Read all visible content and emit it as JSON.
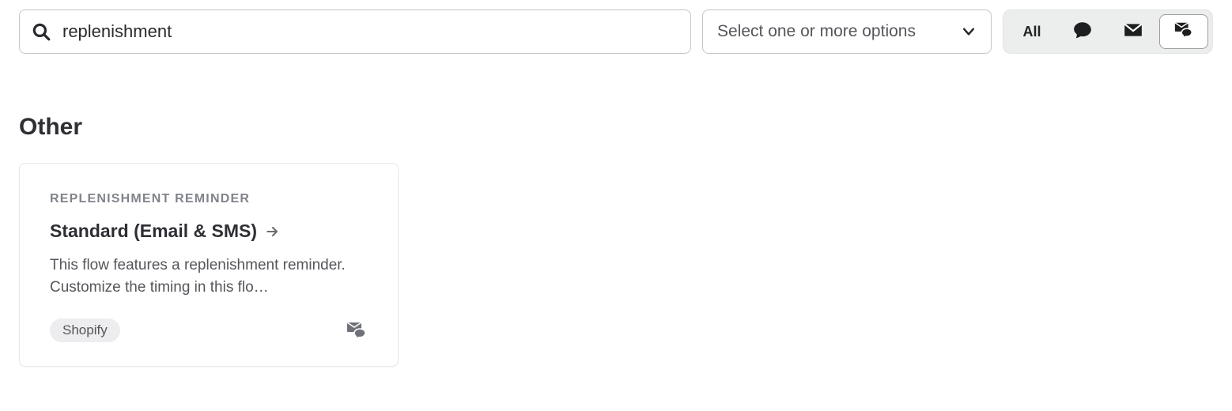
{
  "search": {
    "value": "replenishment",
    "placeholder": ""
  },
  "filter_select": {
    "label": "Select one or more options"
  },
  "channels": {
    "all_label": "All"
  },
  "section": {
    "title": "Other"
  },
  "card": {
    "eyebrow": "REPLENISHMENT REMINDER",
    "title": "Standard (Email & SMS)",
    "description": "This flow features a replenishment reminder. Customize the timing in this flo…",
    "tag": "Shopify"
  }
}
